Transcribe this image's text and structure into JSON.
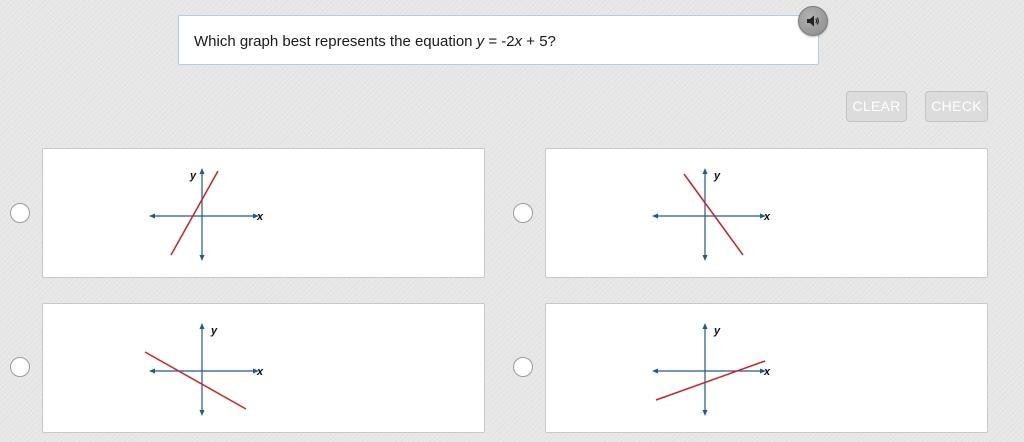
{
  "question": {
    "prefix": "Which graph best represents the equation ",
    "var_y": "y",
    "middle": " = -2",
    "var_x": "x",
    "suffix": " + 5?"
  },
  "audio_button": {
    "icon": "speaker-icon"
  },
  "buttons": {
    "clear": "CLEAR",
    "check": "CHECK"
  },
  "colors": {
    "axis": "#1e5a96",
    "line": "#d42020",
    "button_gray": "#dcdcdc"
  },
  "options": [
    {
      "x_label": "x",
      "y_label": "y",
      "line": "steep positive slope"
    },
    {
      "x_label": "x",
      "y_label": "y",
      "line": "steep negative slope"
    },
    {
      "x_label": "x",
      "y_label": "y",
      "line": "shallow negative slope"
    },
    {
      "x_label": "x",
      "y_label": "y",
      "line": "shallow positive slope"
    }
  ]
}
